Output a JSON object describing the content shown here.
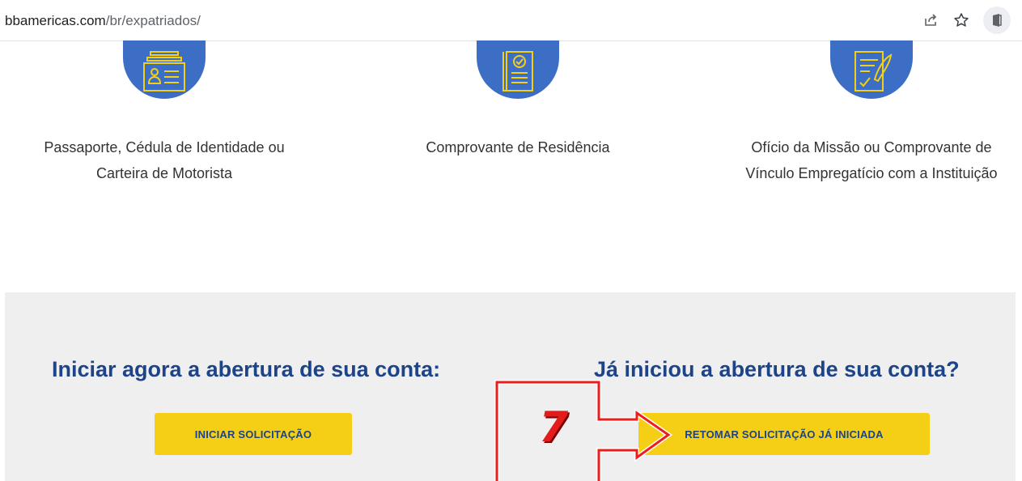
{
  "browser": {
    "url_host": "bbamericas.com",
    "url_path": "/br/expatriados/",
    "icons": [
      "share-icon",
      "bookmark-star-icon",
      "extension-icon"
    ]
  },
  "documents": [
    {
      "icon": "id-card-icon",
      "label_line1": "Passaporte, Cédula de Identidade ou",
      "label_line2": "Carteira de Motorista"
    },
    {
      "icon": "document-check-icon",
      "label_line1": "Comprovante de Residência",
      "label_line2": ""
    },
    {
      "icon": "signed-document-icon",
      "label_line1": "Ofício da Missão ou Comprovante de",
      "label_line2": "Vínculo Empregatício com a Instituição"
    }
  ],
  "cta": {
    "start_title": "Iniciar agora a abertura de sua conta:",
    "start_button": "INICIAR SOLICITAÇÃO",
    "resume_title": "Já iniciou a abertura de sua conta?",
    "resume_button": "RETOMAR SOLICITAÇÃO JÁ INICIADA"
  },
  "annotation": {
    "step_number": "7"
  },
  "colors": {
    "icon_circle": "#3a6ec6",
    "icon_stroke": "#f5cf15",
    "title_blue": "#1d4388",
    "button_yellow": "#f5cf15",
    "section_grey": "#efeff0",
    "annotation_red": "#e31b1b"
  }
}
